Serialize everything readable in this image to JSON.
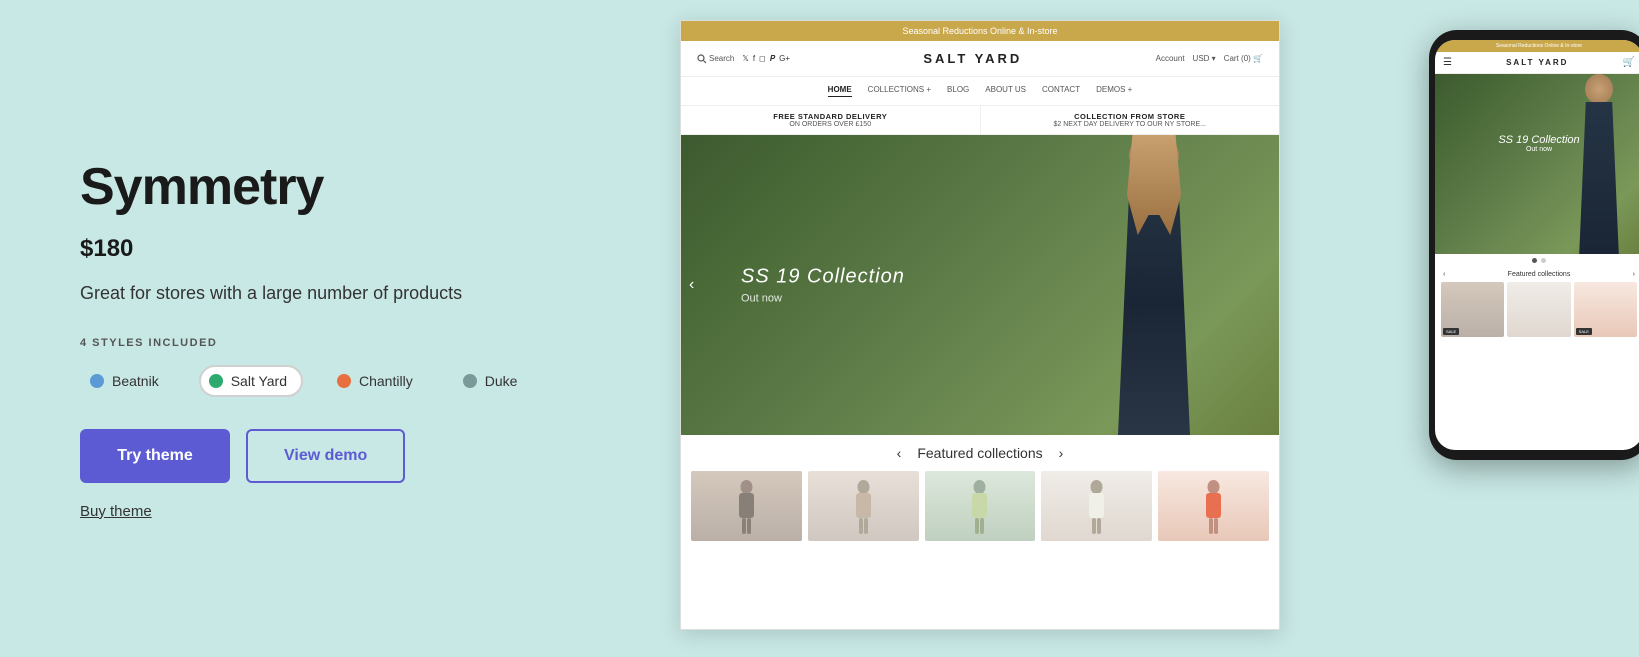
{
  "left": {
    "title": "Symmetry",
    "price": "$180",
    "description": "Great for stores with a large number of products",
    "styles_label": "4 STYLES INCLUDED",
    "styles": [
      {
        "id": "beatnik",
        "name": "Beatnik",
        "color": "#5b9bd5",
        "active": false
      },
      {
        "id": "salt-yard",
        "name": "Salt Yard",
        "color": "#2eaa6e",
        "active": true
      },
      {
        "id": "chantilly",
        "name": "Chantilly",
        "color": "#e87040",
        "active": false
      },
      {
        "id": "duke",
        "name": "Duke",
        "color": "#7a9a9a",
        "active": false
      }
    ],
    "try_button": "Try theme",
    "demo_button": "View demo",
    "buy_link": "Buy theme"
  },
  "preview": {
    "announcement": "Seasonal Reductions Online & In-store",
    "store_name": "SALT YARD",
    "nav_items": [
      "HOME",
      "COLLECTIONS +",
      "BLOG",
      "ABOUT US",
      "CONTACT",
      "DEMOS +"
    ],
    "shipping_items": [
      {
        "title": "FREE STANDARD DELIVERY",
        "subtitle": "ON ORDERS OVER £150"
      },
      {
        "title": "COLLECTION FROM STORE",
        "subtitle": "$2 NEXT DAY DELIVERY TO OUR NY STORE..."
      }
    ],
    "hero_collection": "SS 19 Collection",
    "hero_subtitle": "Out now",
    "featured_label": "Featured collections",
    "account": "Account",
    "currency": "USD",
    "cart": "Cart (0)"
  },
  "mobile": {
    "announcement": "Seasonal Reductions Online & In-store",
    "store_name": "SALT YARD",
    "hero_collection": "SS 19 Collection",
    "hero_subtitle": "Out now",
    "featured_label": "Featured collections"
  }
}
